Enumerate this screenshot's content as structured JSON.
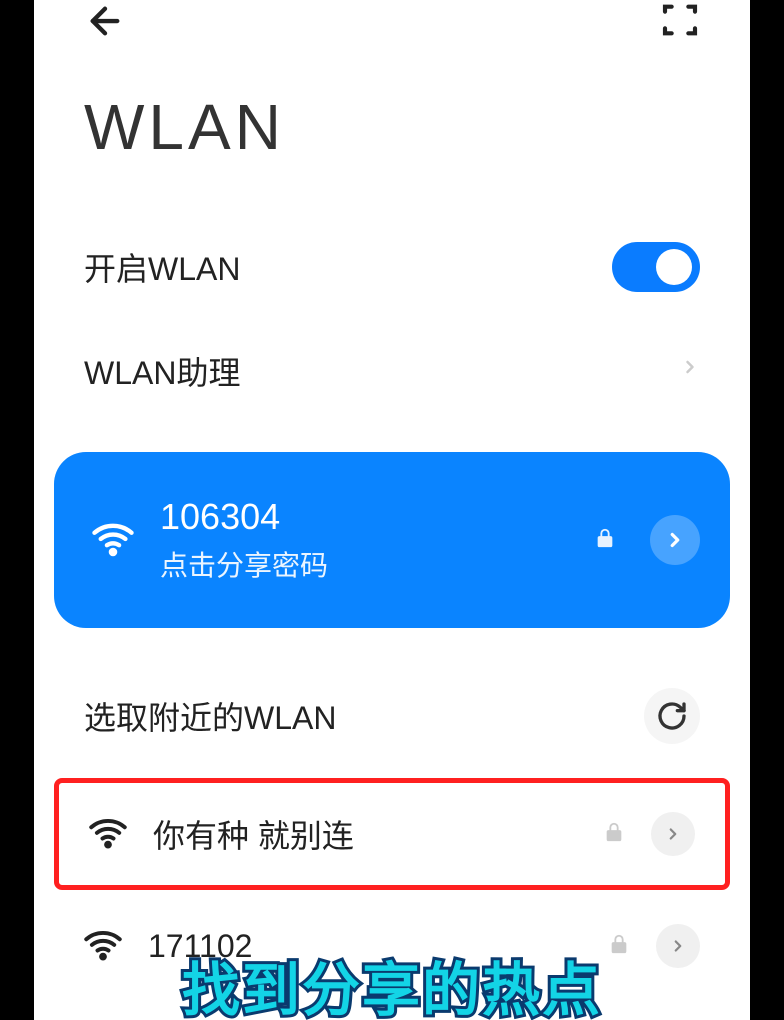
{
  "header": {
    "title": "WLAN"
  },
  "settings": {
    "enable_label": "开启WLAN",
    "assistant_label": "WLAN助理"
  },
  "connected": {
    "ssid": "106304",
    "sub": "点击分享密码"
  },
  "nearby": {
    "section_title": "选取附近的WLAN",
    "highlighted_ssid": "你有种 就别连",
    "item2_ssid": "171102"
  },
  "caption": "找到分享的热点"
}
